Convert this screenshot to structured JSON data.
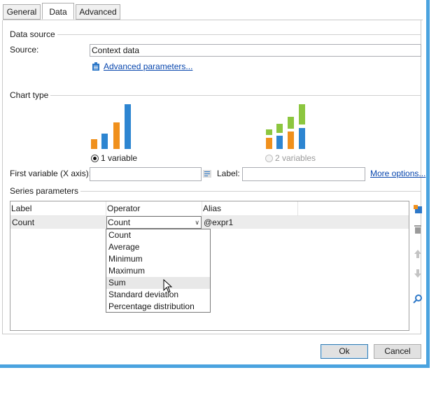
{
  "tabs": [
    {
      "label": "General"
    },
    {
      "label": "Data"
    },
    {
      "label": "Advanced"
    }
  ],
  "data_source": {
    "group_label": "Data source",
    "source_label": "Source:",
    "source_value": "Context data",
    "advanced_link": "Advanced parameters..."
  },
  "chart_type": {
    "group_label": "Chart type",
    "option_one": "1 variable",
    "option_two": "2 variables",
    "selected": "1 variable",
    "one_var_colors": [
      "#f0901c",
      "#2d85d1"
    ],
    "two_var_colors": [
      "#f0901c",
      "#8cc63f",
      "#2d85d1"
    ]
  },
  "first_variable": {
    "label": "First variable (X axis):",
    "value": "",
    "label_label": "Label:",
    "label_value": "",
    "more_options": "More options..."
  },
  "series": {
    "group_label": "Series parameters",
    "columns": [
      "Label",
      "Operator",
      "Alias"
    ],
    "rows": [
      {
        "label": "Count",
        "operator": "Count",
        "alias": "@expr1"
      }
    ],
    "dropdown_options": [
      "Count",
      "Average",
      "Minimum",
      "Maximum",
      "Sum",
      "Standard deviation",
      "Percentage distribution"
    ],
    "highlighted_option": "Sum"
  },
  "buttons": {
    "ok": "Ok",
    "cancel": "Cancel"
  }
}
